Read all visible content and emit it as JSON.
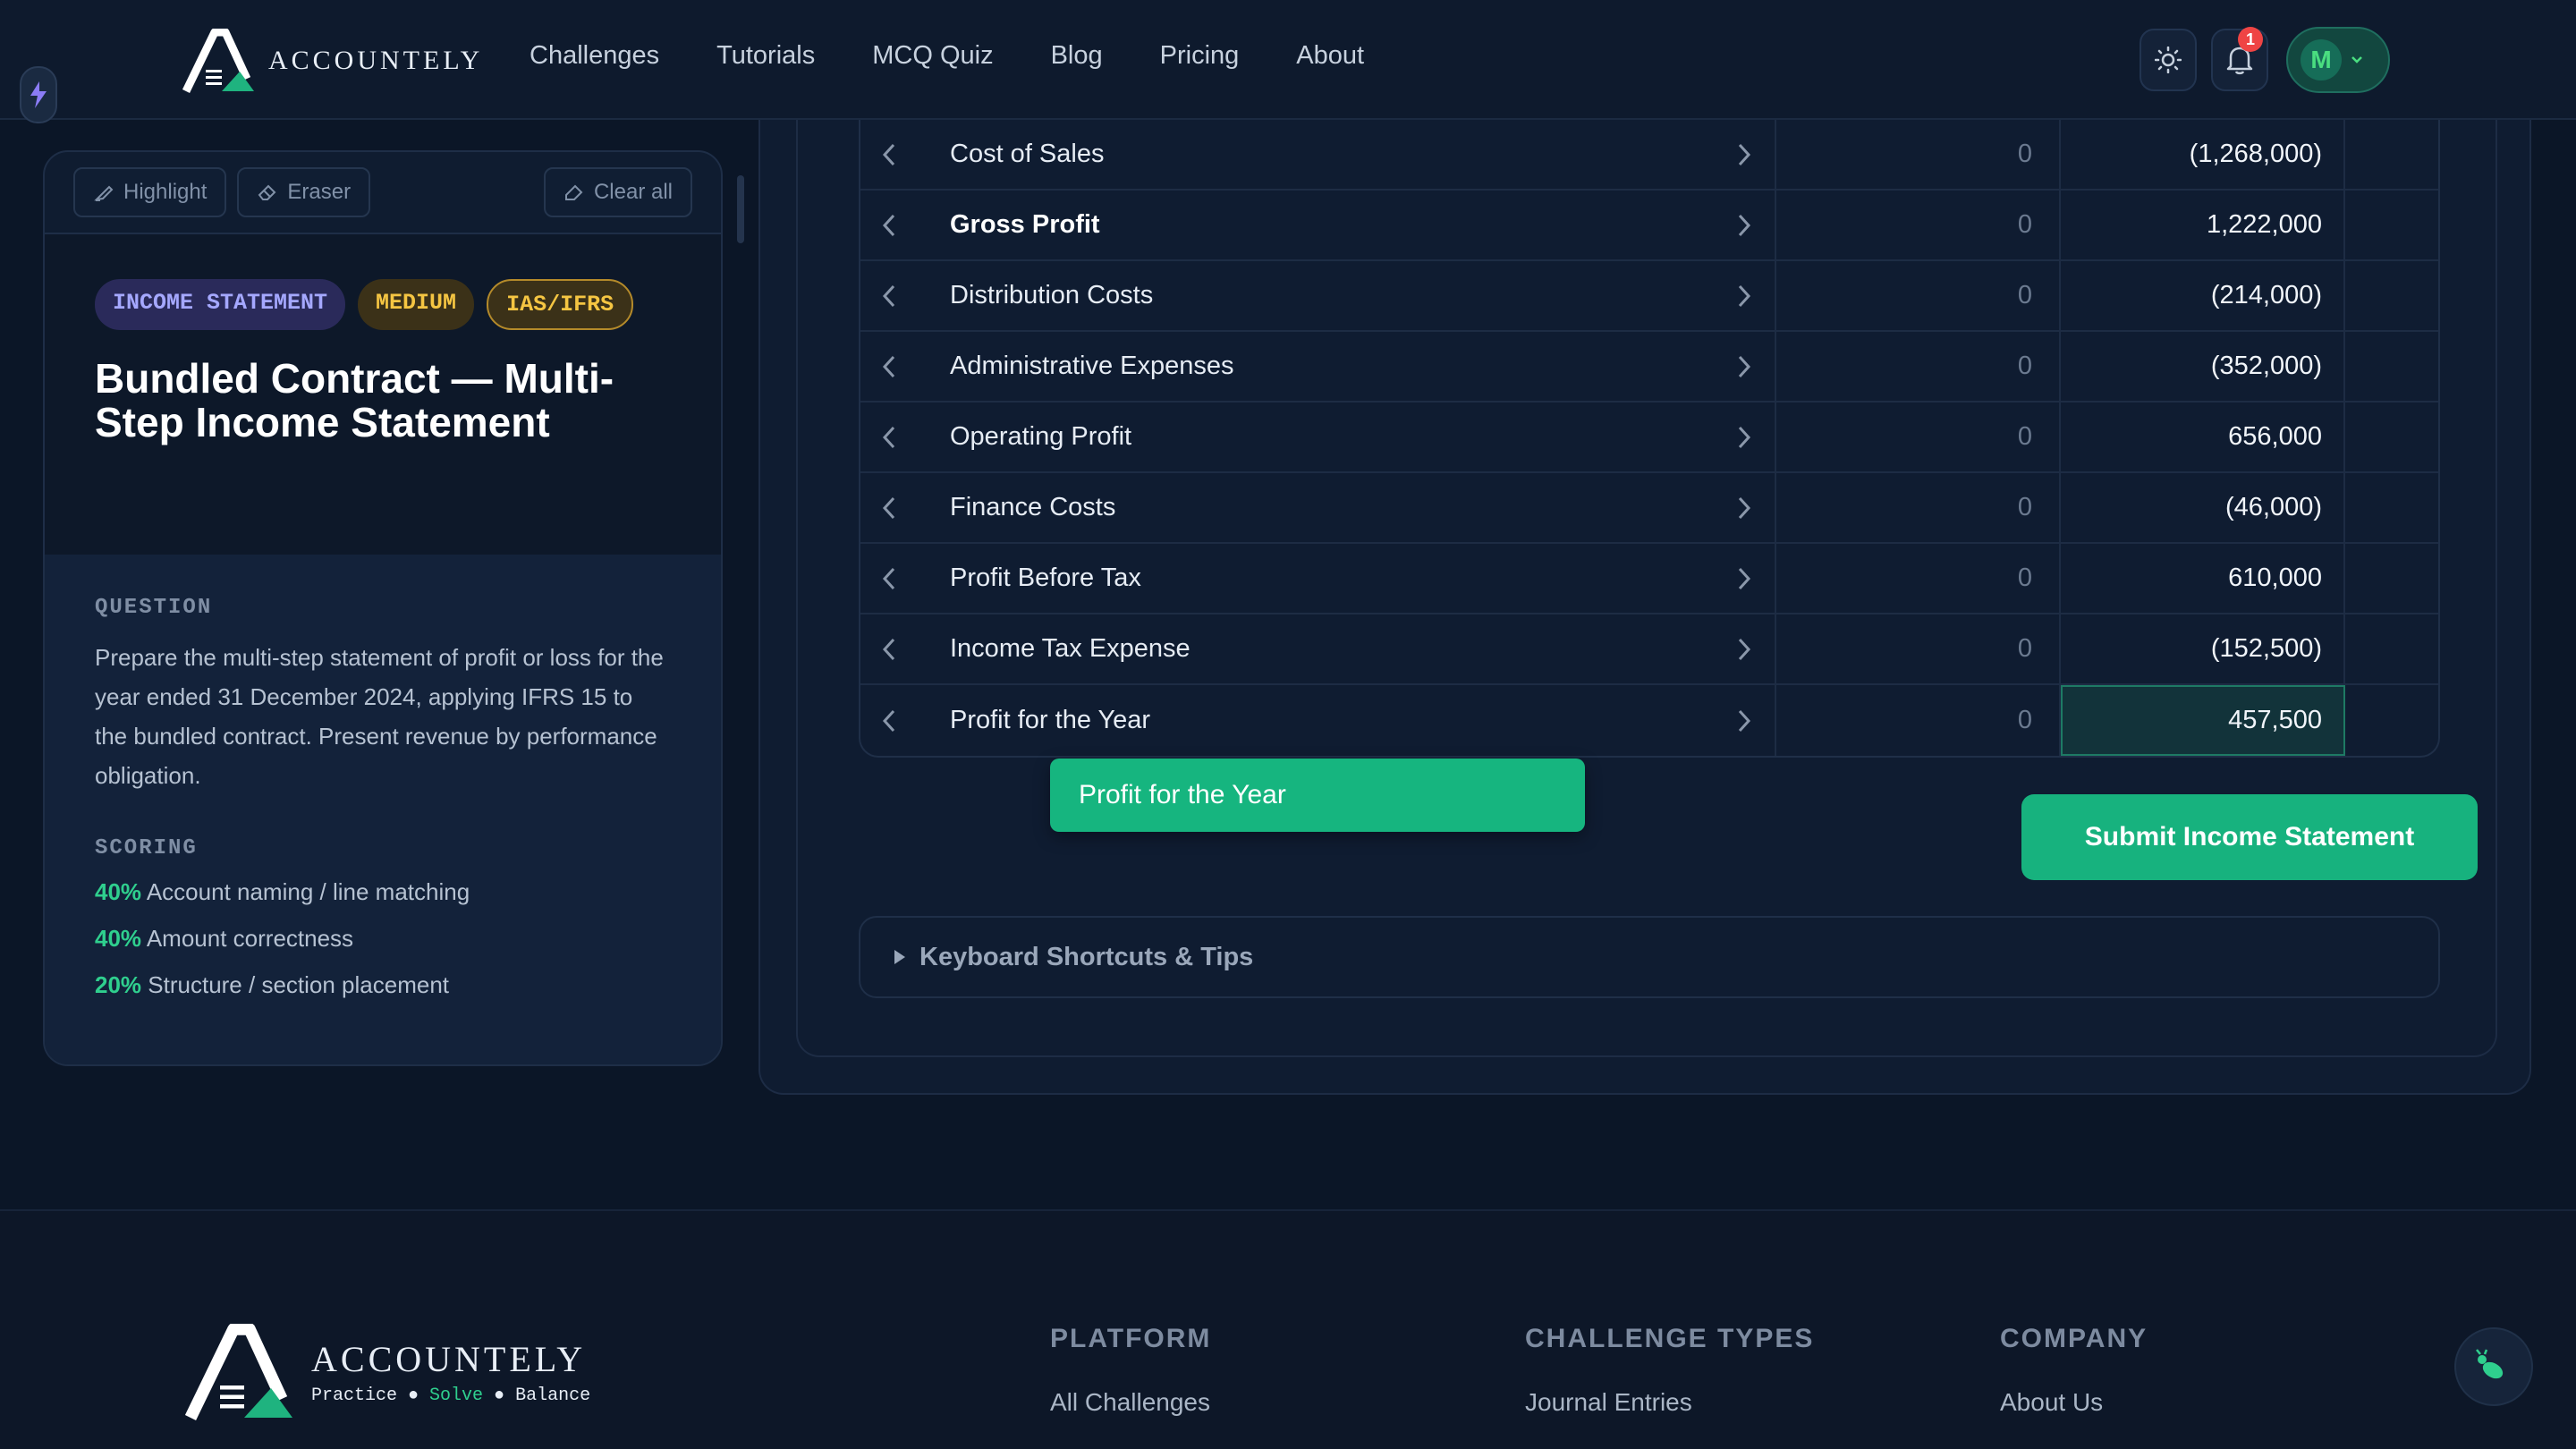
{
  "nav": {
    "brand": "ACCOUNTELY",
    "links": [
      "Challenges",
      "Tutorials",
      "MCQ Quiz",
      "Blog",
      "Pricing",
      "About"
    ],
    "notification_count": "1",
    "user_initial": "M"
  },
  "tools": {
    "highlight": "Highlight",
    "eraser": "Eraser",
    "clear_all": "Clear all"
  },
  "challenge": {
    "tags": [
      "INCOME STATEMENT",
      "MEDIUM",
      "IAS/IFRS"
    ],
    "title": "Bundled Contract — Multi-Step Income Statement",
    "question_label": "QUESTION",
    "question": "Prepare the multi-step statement of profit or loss for the year ended 31 December 2024, applying IFRS 15 to the bundled contract. Present revenue by performance obligation.",
    "scoring_label": "SCORING",
    "scoring": [
      {
        "pct": "40%",
        "text": "Account naming / line matching"
      },
      {
        "pct": "40%",
        "text": "Amount correctness"
      },
      {
        "pct": "20%",
        "text": "Structure / section placement"
      }
    ]
  },
  "statement": {
    "rows": [
      {
        "label": "Cost of Sales",
        "prev": "0",
        "amount": "(1,268,000)"
      },
      {
        "label": "Gross Profit",
        "prev": "0",
        "amount": "1,222,000"
      },
      {
        "label": "Distribution Costs",
        "prev": "0",
        "amount": "(214,000)"
      },
      {
        "label": "Administrative Expenses",
        "prev": "0",
        "amount": "(352,000)"
      },
      {
        "label": "Operating Profit",
        "prev": "0",
        "amount": "656,000"
      },
      {
        "label": "Finance Costs",
        "prev": "0",
        "amount": "(46,000)"
      },
      {
        "label": "Profit Before Tax",
        "prev": "0",
        "amount": "610,000"
      },
      {
        "label": "Income Tax Expense",
        "prev": "0",
        "amount": "(152,500)"
      },
      {
        "label": "Profit for the Year",
        "prev": "0",
        "amount": "457,500"
      }
    ],
    "drag_chip": "Profit for the Year",
    "submit": "Submit Income Statement",
    "shortcuts": "Keyboard Shortcuts & Tips"
  },
  "footer": {
    "brand": "ACCOUNTELY",
    "tagline": [
      "Practice",
      "Solve",
      "Balance"
    ],
    "columns": [
      {
        "heading": "PLATFORM",
        "link": "All Challenges"
      },
      {
        "heading": "CHALLENGE TYPES",
        "link": "Journal Entries"
      },
      {
        "heading": "COMPANY",
        "link": "About Us"
      }
    ]
  },
  "colors": {
    "accent": "#17b27e",
    "background": "#0b1627",
    "tag_topic": "#a5a8ff",
    "tag_level": "#f5c542"
  }
}
